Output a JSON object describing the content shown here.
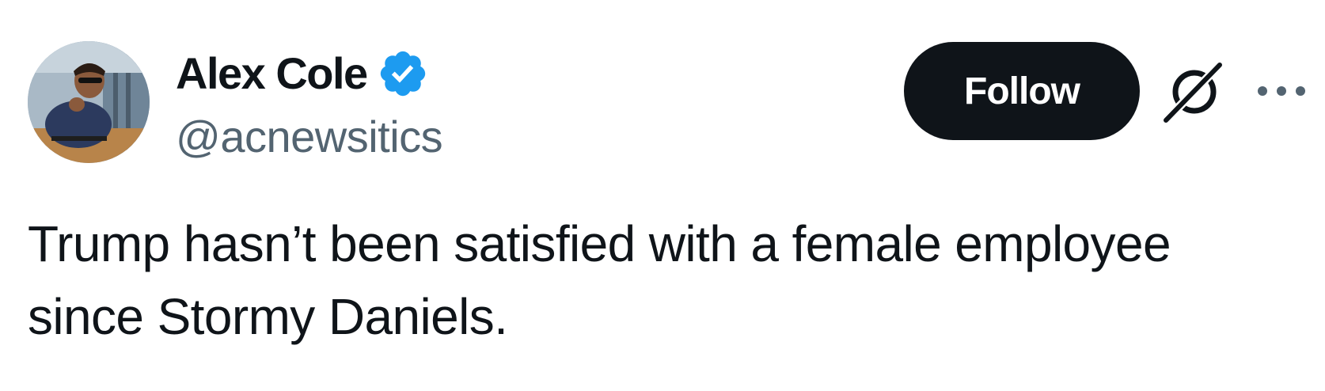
{
  "user": {
    "display_name": "Alex Cole",
    "handle": "@acnewsitics",
    "verified": true
  },
  "actions": {
    "follow_label": "Follow"
  },
  "tweet": {
    "text": "Trump hasn’t been satisfied with a female employee since Stormy Daniels."
  },
  "icons": {
    "verified": "verified-badge-icon",
    "grok": "grok-icon",
    "more": "more-options-icon"
  },
  "colors": {
    "text_primary": "#0f1419",
    "text_secondary": "#536471",
    "verified_blue": "#1d9bf0",
    "button_bg": "#0f1419",
    "button_text": "#ffffff"
  }
}
